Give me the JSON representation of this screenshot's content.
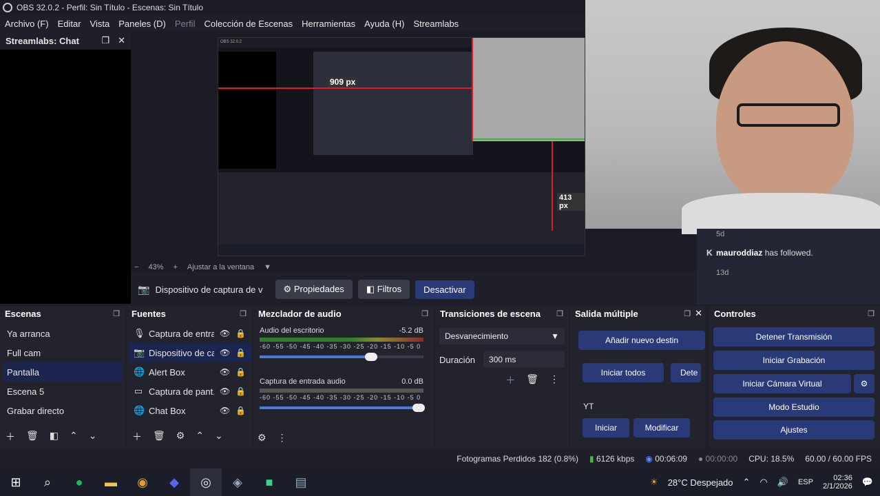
{
  "title": "OBS 32.0.2 - Perfil: Sin Título - Escenas: Sin Título",
  "menu": [
    "Archivo (F)",
    "Editar",
    "Vista",
    "Paneles (D)",
    "Perfil",
    "Colección de Escenas",
    "Herramientas",
    "Ayuda (H)",
    "Streamlabs"
  ],
  "chat_dock": {
    "title": "Streamlabs: Chat"
  },
  "preview": {
    "zoom": "43%",
    "fit_label": "Ajustar a la ventana",
    "measure_top": "909 px",
    "measure_right": "413 px"
  },
  "context_bar": {
    "source_name": "Dispositivo de captura de v",
    "properties": "Propiedades",
    "filters": "Filtros",
    "deactivate": "Desactivar"
  },
  "chat_overlay": {
    "time1": "5d",
    "msg_user": "mauroddiaz",
    "msg_text": "has followed.",
    "time2": "13d"
  },
  "scenes": {
    "title": "Escenas",
    "items": [
      "Ya arranca",
      "Full cam",
      "Pantalla",
      "Escena 5",
      "Grabar directo"
    ],
    "selected": "Pantalla"
  },
  "sources": {
    "title": "Fuentes",
    "items": [
      "Captura de entra",
      "Dispositivo de ca",
      "Alert Box",
      "Captura de pant.",
      "Chat Box"
    ]
  },
  "mixer": {
    "title": "Mezclador de audio",
    "tracks": [
      {
        "name": "Audio del escritorio",
        "db": "-5.2 dB",
        "level": 0.75,
        "volume": 0.68
      },
      {
        "name": "Captura de entrada audio",
        "db": "0.0 dB",
        "level": 0.0,
        "volume": 0.97
      }
    ],
    "scale": "-60 -55 -50 -45 -40 -35 -30 -25 -20 -15 -10 -5 0"
  },
  "transitions": {
    "title": "Transiciones de escena",
    "selected": "Desvanecimiento",
    "duration_label": "Duración",
    "duration_value": "300 ms"
  },
  "multi_output": {
    "title": "Salida múltiple",
    "add": "Añadir nuevo destin",
    "start_all": "Iniciar todos",
    "stop_all": "Dete",
    "target_name": "YT",
    "start": "Iniciar",
    "modify": "Modificar"
  },
  "controls": {
    "title": "Controles",
    "buttons": [
      "Detener Transmisión",
      "Iniciar Grabación",
      "Iniciar Cámara Virtual",
      "Modo Estudio",
      "Ajustes"
    ]
  },
  "status": {
    "dropped": "Fotogramas Perdidos 182 (0.8%)",
    "bitrate": "6126 kbps",
    "stream_time": "00:06:09",
    "rec_time": "00:00:00",
    "cpu": "CPU: 18.5%",
    "fps": "60.00 / 60.00 FPS"
  },
  "taskbar": {
    "weather": "28°C  Despejado",
    "lang": "ESP",
    "time": "02:36",
    "date": "2/1/2026"
  },
  "colors": {
    "accent": "#2a3a78",
    "selection": "#1c2550",
    "bg": "#1e1f29"
  }
}
